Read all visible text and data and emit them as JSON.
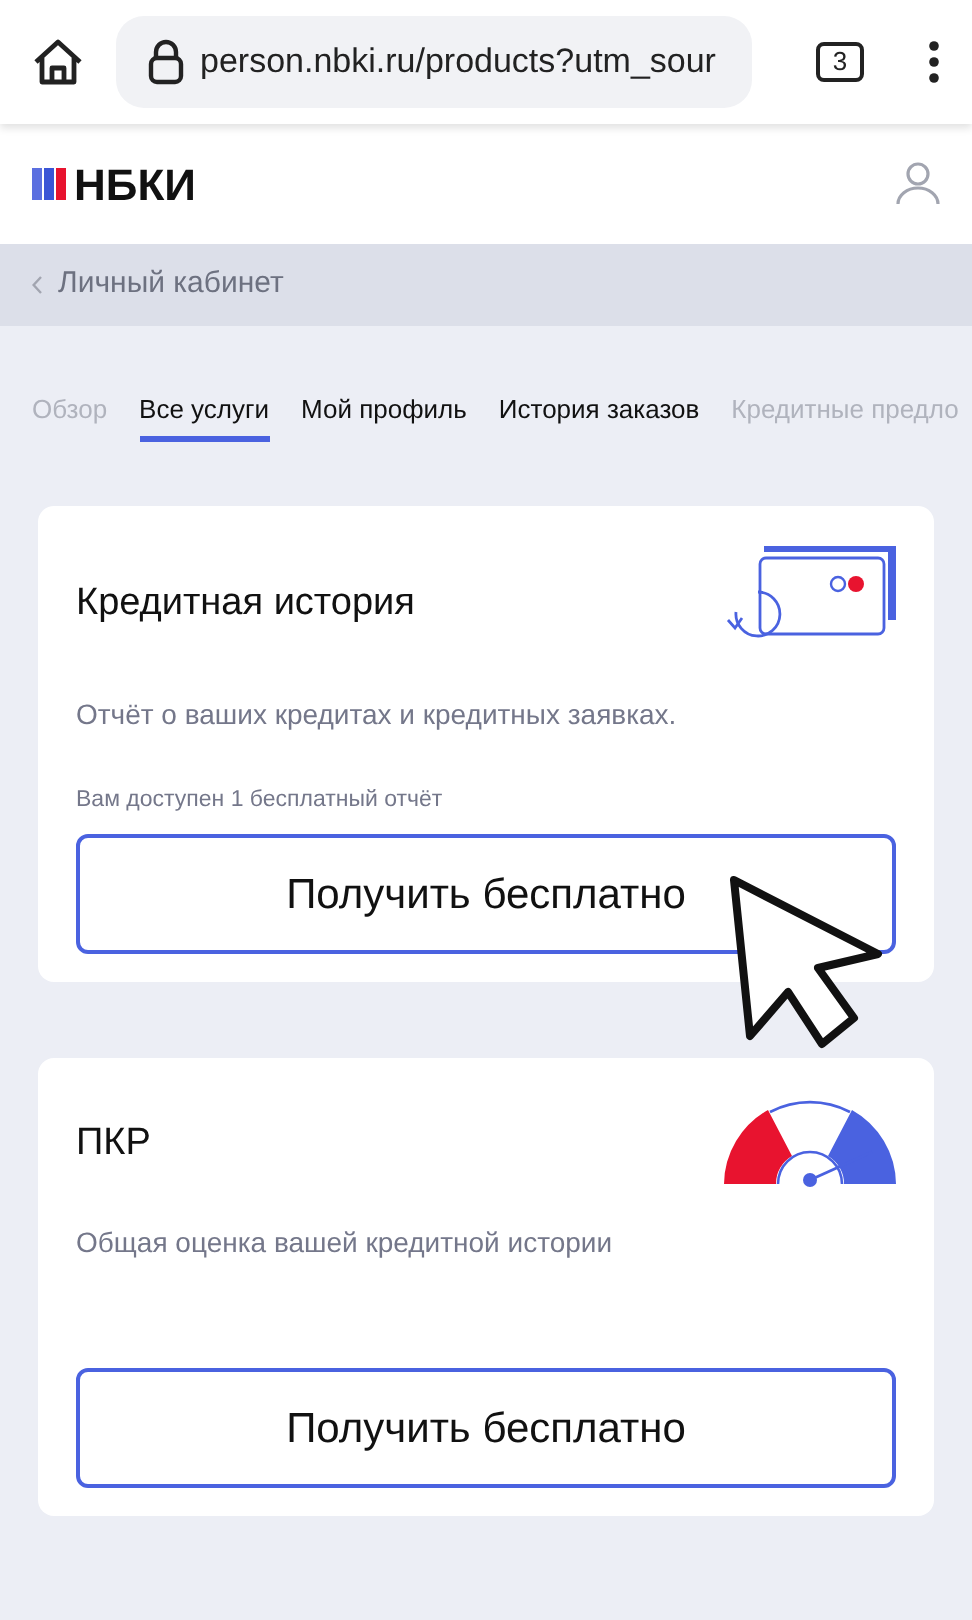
{
  "browser": {
    "url": "person.nbki.ru/products?utm_sour",
    "tab_count": "3"
  },
  "header": {
    "logo_text": "НБКИ"
  },
  "breadcrumb": {
    "label": "Личный кабинет"
  },
  "tabs": [
    {
      "label": "Обзор",
      "selected": false,
      "faded": true
    },
    {
      "label": "Все услуги",
      "selected": true,
      "faded": false
    },
    {
      "label": "Мой профиль",
      "selected": false,
      "faded": false
    },
    {
      "label": "История заказов",
      "selected": false,
      "faded": false
    },
    {
      "label": "Кредитные предло",
      "selected": false,
      "faded": true
    }
  ],
  "cards": [
    {
      "kind": "credit-card",
      "title": "Кредитная история",
      "description": "Отчёт о ваших кредитах и кредитных заявках.",
      "note": "Вам доступен 1 бесплатный отчёт",
      "button": "Получить бесплатно",
      "pointer": true
    },
    {
      "kind": "gauge",
      "title": "ПКР",
      "description": "Общая оценка вашей кредитной истории",
      "button": "Получить бесплатно",
      "pointer": false
    }
  ]
}
